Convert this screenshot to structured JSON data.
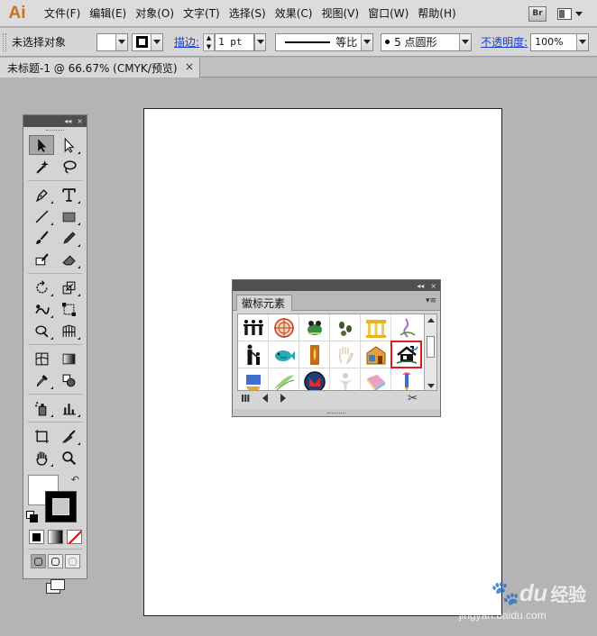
{
  "app": {
    "logo": "Ai"
  },
  "menu": {
    "items": [
      "文件(F)",
      "编辑(E)",
      "对象(O)",
      "文字(T)",
      "选择(S)",
      "效果(C)",
      "视图(V)",
      "窗口(W)",
      "帮助(H)"
    ],
    "bridge_label": "Br"
  },
  "control_bar": {
    "selection_status": "未选择对象",
    "stroke_label": "描边:",
    "stroke_weight": "1 pt",
    "stroke_profile": "等比",
    "brush_def": "5 点圆形",
    "opacity_label": "不透明度:",
    "opacity_value": "100%"
  },
  "document_tab": {
    "title": "未标题-1 @ 66.67% (CMYK/预览)",
    "close": "×"
  },
  "tools_panel": {
    "collapse_glyph": "◂◂",
    "close_glyph": "×",
    "swap_glyph": "↶"
  },
  "symbols_panel": {
    "tab_label": "徽标元素",
    "menu_glyph": "▾≡",
    "collapse_glyph": "◂◂",
    "close_glyph": "×",
    "library_button": "Ⅲ",
    "place_symbol_glyph": "✂",
    "selected_symbol_index": 11
  },
  "watermark": {
    "brand": "Bai",
    "brand_tail": "du",
    "product": "经验",
    "url": "jingyan.baidu.com"
  },
  "colors": {
    "accent_link": "#1a3fd0",
    "selection_outline": "#e01b1b",
    "ai_logo": "#c8741a"
  }
}
